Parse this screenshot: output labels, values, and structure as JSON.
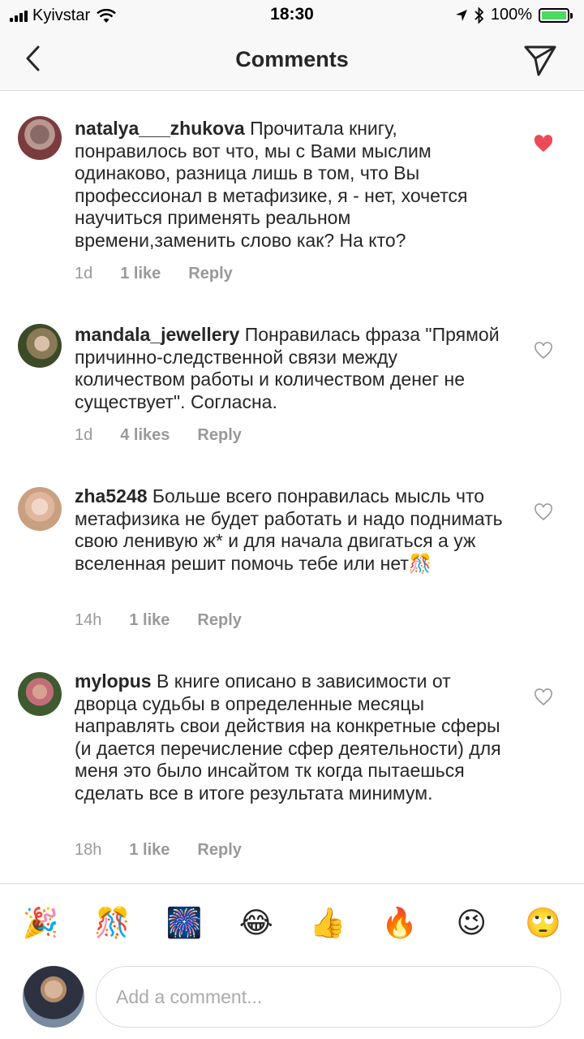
{
  "status_bar": {
    "carrier": "Kyivstar",
    "time": "18:30",
    "battery": "100%",
    "battery_level": 1.0,
    "icons": [
      "signal-icon",
      "wifi-icon",
      "location-icon",
      "bluetooth-icon",
      "battery-icon"
    ]
  },
  "header": {
    "title": "Comments",
    "back_icon": "chevron-left-icon",
    "send_icon": "paper-plane-icon"
  },
  "comments": [
    {
      "username": "natalya___zhukova",
      "text": "Прочитала книгу, понравилось вот что, мы с Вами мыслим одинаково, разница лишь в том, что Вы профессионал в метафизике, я - нет, хочется научиться применять реальном времени,заменить слово как? На кто?",
      "time": "1d",
      "likes": "1 like",
      "reply": "Reply",
      "liked": true
    },
    {
      "username": "mandala_jewellery",
      "text": "Понравилась фраза \"Прямой причинно-следственной связи между количеством работы и количеством денег не существует\". Согласна.",
      "time": "1d",
      "likes": "4 likes",
      "reply": "Reply",
      "liked": false
    },
    {
      "username": "zha5248",
      "text": "Больше всего понравилась мысль что метафизика не будет работать и надо поднимать свою ленивую ж* и для начала двигаться а уж вселенная решит помочь тебе или нет🎊",
      "time": "14h",
      "likes": "1 like",
      "reply": "Reply",
      "liked": false
    },
    {
      "username": "mylopus",
      "text": "В книге описано в зависимости от дворца судьбы в определенные месяцы направлять свои действия на конкретные сферы (и дается перечисление сфер деятельности) для меня это было инсайтом тк когда пытаешься сделать все в итоге результата минимум.",
      "time": "18h",
      "likes": "1 like",
      "reply": "Reply",
      "liked": false
    }
  ],
  "emoji_bar": [
    "🎉",
    "🎊",
    "🎆",
    "😂",
    "👍",
    "🔥",
    "😉",
    "🙄"
  ],
  "composer": {
    "placeholder": "Add a comment..."
  },
  "colors": {
    "like_red": "#ed4956",
    "secondary_text": "#999999",
    "divider": "#dbdbdb",
    "battery_green": "#4cd964"
  }
}
